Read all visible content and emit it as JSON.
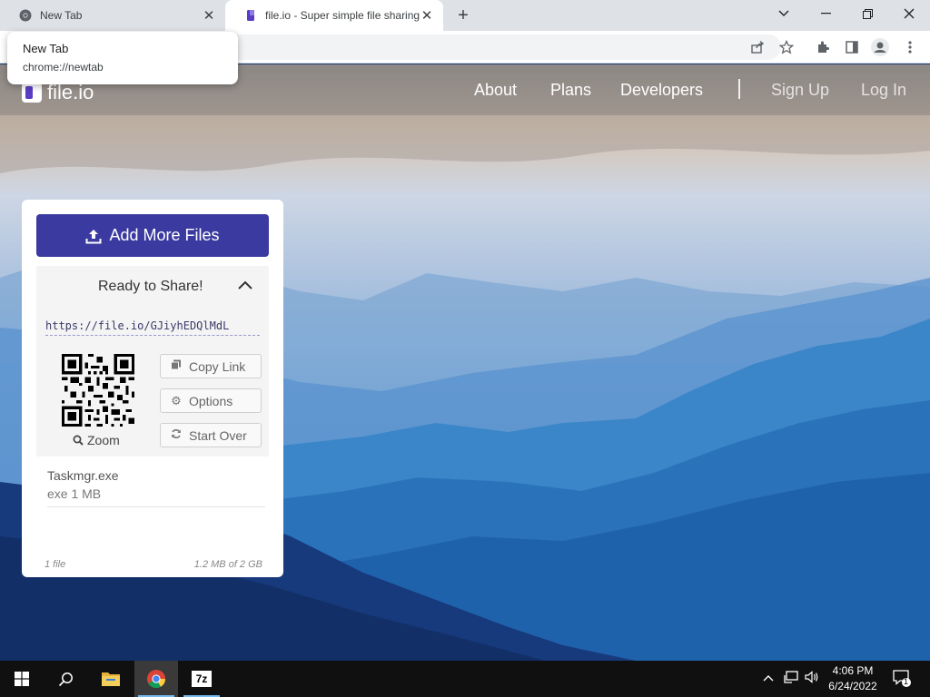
{
  "browser": {
    "tabs": [
      {
        "title": "New Tab",
        "active": false
      },
      {
        "title": "file.io - Super simple file sharing",
        "active": true
      }
    ],
    "new_tab_symbol": "+",
    "window_controls": {
      "dropdown": "⌄",
      "minimize": "—",
      "maximize": "❐",
      "close": "✕"
    },
    "hovercard": {
      "title": "New Tab",
      "url": "chrome://newtab"
    },
    "toolbar_icons": [
      "share-icon",
      "bookmark-star-icon",
      "extensions-icon",
      "side-panel-icon",
      "profile-icon",
      "menu-icon"
    ]
  },
  "site": {
    "logo_text": "file.io",
    "nav": {
      "about": "About",
      "plans": "Plans",
      "developers": "Developers",
      "sign_up": "Sign Up",
      "log_in": "Log In"
    }
  },
  "upload": {
    "add_button": "Add More Files",
    "status": "Ready to Share!",
    "link": "https://file.io/GJiyhEDQlMdL",
    "zoom": "Zoom",
    "actions": {
      "copy": "Copy Link",
      "options": "Options",
      "start_over": "Start Over"
    },
    "file": {
      "name": "Taskmgr.exe",
      "meta": "exe 1 MB"
    },
    "footer": {
      "count": "1 file",
      "quota": "1.2 MB of 2 GB"
    }
  },
  "taskbar": {
    "apps": [
      "start-icon",
      "search-icon",
      "file-explorer-icon",
      "chrome-icon",
      "7zip-icon"
    ],
    "seven_zip_label": "7z",
    "time": "4:06 PM",
    "date": "6/24/2022",
    "notification_count": "1"
  },
  "colors": {
    "accent": "#3b3aa0",
    "taskbar": "#101010"
  }
}
